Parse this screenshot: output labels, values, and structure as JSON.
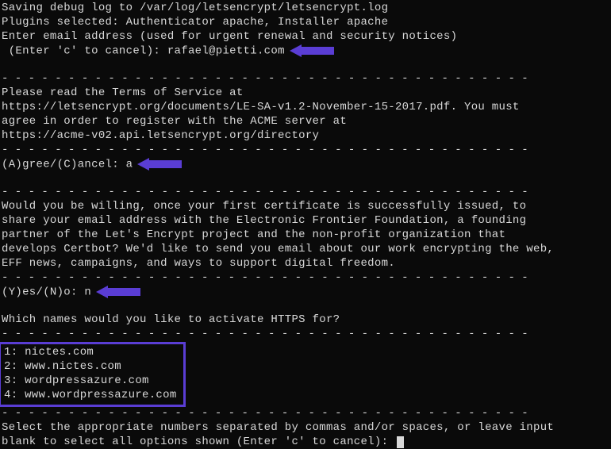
{
  "intro": {
    "debug_log": "Saving debug log to /var/log/letsencrypt/letsencrypt.log",
    "plugins": "Plugins selected: Authenticator apache, Installer apache",
    "email_prompt": "Enter email address (used for urgent renewal and security notices)",
    "cancel_prefix": " (Enter 'c' to cancel): ",
    "email_input": "rafael@pietti.com"
  },
  "dashed_short": "- - - - - - - - - - - - - - - - - - - - - - - - - - - - - - - - - - - - - - - -",
  "tos": {
    "line1": "Please read the Terms of Service at",
    "line2": "https://letsencrypt.org/documents/LE-SA-v1.2-November-15-2017.pdf. You must",
    "line3": "agree in order to register with the ACME server at",
    "line4": "https://acme-v02.api.letsencrypt.org/directory"
  },
  "agree": {
    "prompt": "(A)gree/(C)ancel: ",
    "answer": "a"
  },
  "eff": {
    "line1": "Would you be willing, once your first certificate is successfully issued, to",
    "line2": "share your email address with the Electronic Frontier Foundation, a founding",
    "line3": "partner of the Let's Encrypt project and the non-profit organization that",
    "line4": "develops Certbot? We'd like to send you email about our work encrypting the web,",
    "line5": "EFF news, campaigns, and ways to support digital freedom."
  },
  "yesno": {
    "prompt": "(Y)es/(N)o: ",
    "answer": "n"
  },
  "activate_prompt": "Which names would you like to activate HTTPS for?",
  "domains": {
    "d1": "1: nictes.com",
    "d2": "2: www.nictes.com",
    "d3": "3: wordpressazure.com",
    "d4": "4: www.wordpressazure.com"
  },
  "select": {
    "line1": "Select the appropriate numbers separated by commas and/or spaces, or leave input",
    "line2": "blank to select all options shown (Enter 'c' to cancel): "
  }
}
